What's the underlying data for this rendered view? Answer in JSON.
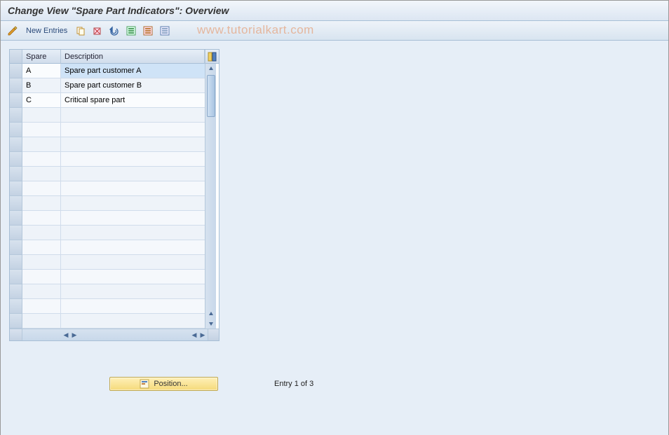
{
  "title": "Change View \"Spare Part Indicators\": Overview",
  "toolbar": {
    "new_entries": "New Entries"
  },
  "watermark": "www.tutorialkart.com",
  "table": {
    "columns": {
      "spare": "Spare",
      "description": "Description"
    },
    "rows": [
      {
        "spare": "A",
        "description": "Spare part customer A",
        "selected": true
      },
      {
        "spare": "B",
        "description": "Spare part customer B",
        "selected": false
      },
      {
        "spare": "C",
        "description": "Critical spare part",
        "selected": false
      }
    ],
    "empty_rows": 15
  },
  "footer": {
    "position_label": "Position...",
    "entry_status": "Entry 1 of 3"
  }
}
